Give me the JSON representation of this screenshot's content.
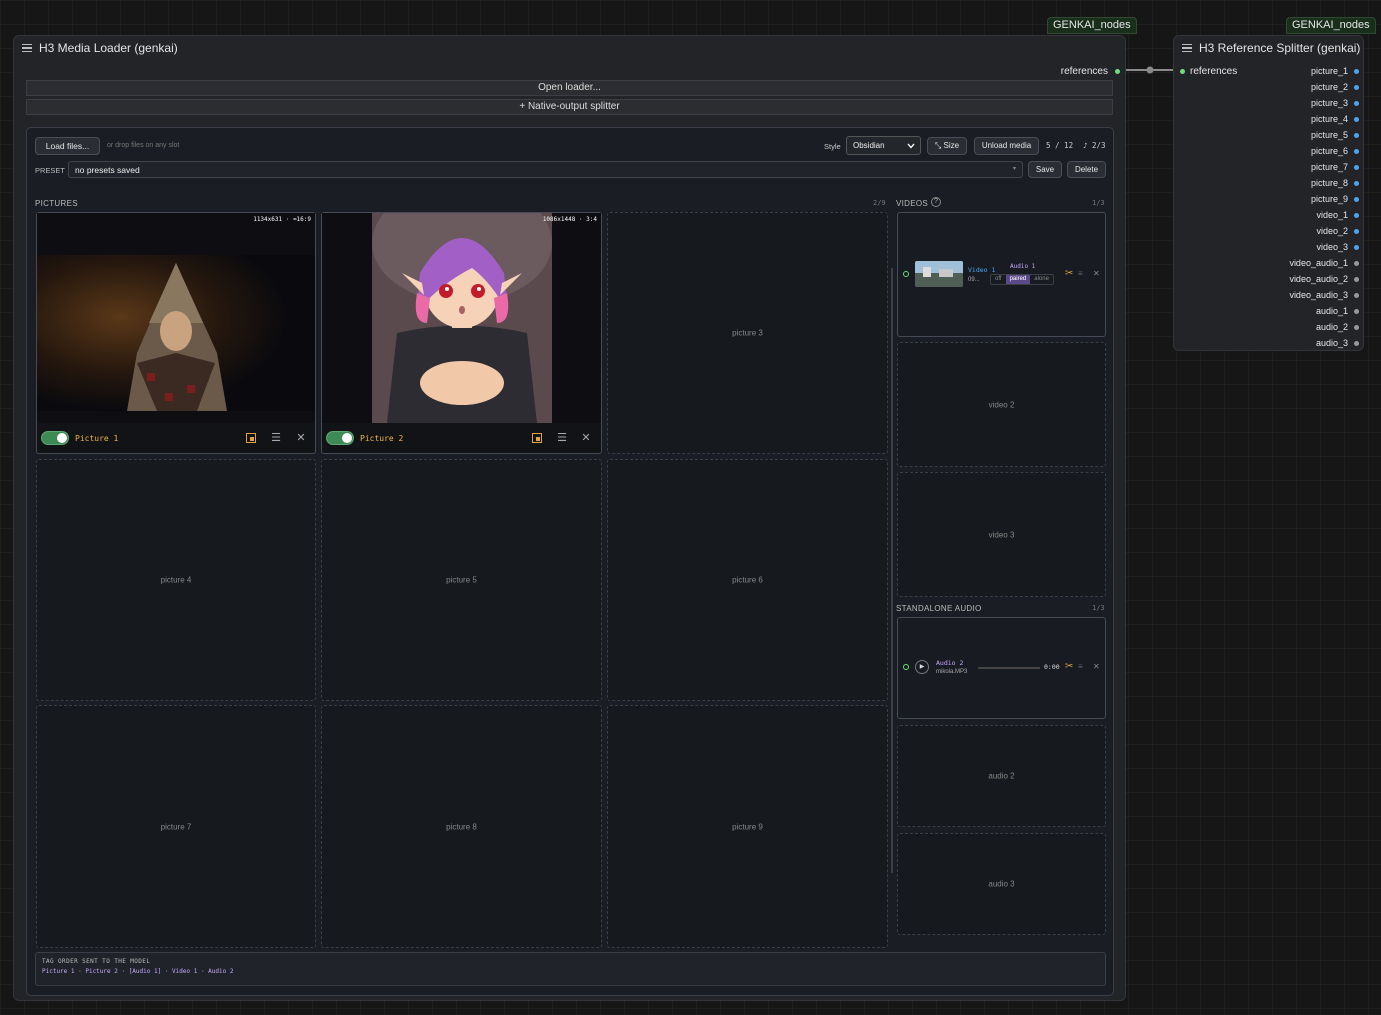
{
  "badges": {
    "left": "GENKAI_nodes",
    "right": "GENKAI_nodes"
  },
  "loader": {
    "title": "H3 Media Loader (genkai)",
    "output_label": "references",
    "open_loader": "Open loader...",
    "native_output": "+ Native-output splitter",
    "toolbar": {
      "load_files": "Load files...",
      "drop_hint": "or drop files on any slot",
      "style_label": "Style",
      "style_value": "Obsidian",
      "size_btn": "⤡ Size",
      "unload_btn": "Unload media",
      "count_media": "5 / 12",
      "count_audio": "♪ 2/3"
    },
    "preset": {
      "label": "PRESET",
      "value": "no presets saved",
      "save": "Save",
      "delete": "Delete"
    },
    "pictures": {
      "label": "PICTURES",
      "count": "2/9",
      "slots": [
        {
          "name": "Picture 1",
          "dims": "1134x631 · ≈16:9",
          "enabled": true
        },
        {
          "name": "Picture 2",
          "dims": "1086x1448 · 3:4",
          "enabled": true
        },
        {
          "empty": "picture 3"
        },
        {
          "empty": "picture 4"
        },
        {
          "empty": "picture 5"
        },
        {
          "empty": "picture 6"
        },
        {
          "empty": "picture 7"
        },
        {
          "empty": "picture 8"
        },
        {
          "empty": "picture 9"
        }
      ]
    },
    "videos": {
      "label": "VIDEOS",
      "help": "?",
      "count": "1/3",
      "video1": {
        "name": "Video 1",
        "file": "09...",
        "audio_label": "Audio 1",
        "modes": [
          "off",
          "paired",
          "alone"
        ],
        "active_mode": "paired"
      },
      "empty2": "video 2",
      "empty3": "video 3"
    },
    "audio": {
      "label": "STANDALONE AUDIO",
      "count": "1/3",
      "audio1": {
        "name": "Audio 2",
        "file": "mikola.MP3",
        "time": "0:00"
      },
      "empty2": "audio 2",
      "empty3": "audio 3"
    },
    "tag_order": {
      "label": "TAG ORDER SENT TO THE MODEL",
      "value": "Picture 1 · Picture 2 · [Audio 1] · Video 1 · Audio 2"
    }
  },
  "splitter": {
    "title": "H3 Reference Splitter (genkai)",
    "input_label": "references",
    "outputs": [
      {
        "name": "picture_1",
        "type": "image"
      },
      {
        "name": "picture_2",
        "type": "image"
      },
      {
        "name": "picture_3",
        "type": "image"
      },
      {
        "name": "picture_4",
        "type": "image"
      },
      {
        "name": "picture_5",
        "type": "image"
      },
      {
        "name": "picture_6",
        "type": "image"
      },
      {
        "name": "picture_7",
        "type": "image"
      },
      {
        "name": "picture_8",
        "type": "image"
      },
      {
        "name": "picture_9",
        "type": "image"
      },
      {
        "name": "video_1",
        "type": "image"
      },
      {
        "name": "video_2",
        "type": "image"
      },
      {
        "name": "video_3",
        "type": "image"
      },
      {
        "name": "video_audio_1",
        "type": "audio"
      },
      {
        "name": "video_audio_2",
        "type": "audio"
      },
      {
        "name": "video_audio_3",
        "type": "audio"
      },
      {
        "name": "audio_1",
        "type": "audio"
      },
      {
        "name": "audio_2",
        "type": "audio"
      },
      {
        "name": "audio_3",
        "type": "audio"
      }
    ]
  },
  "colors": {
    "image_port": "#4aa3f0",
    "audio_port": "#9a9a9a",
    "link": "#6de07a",
    "accent": "#f0b44a"
  }
}
